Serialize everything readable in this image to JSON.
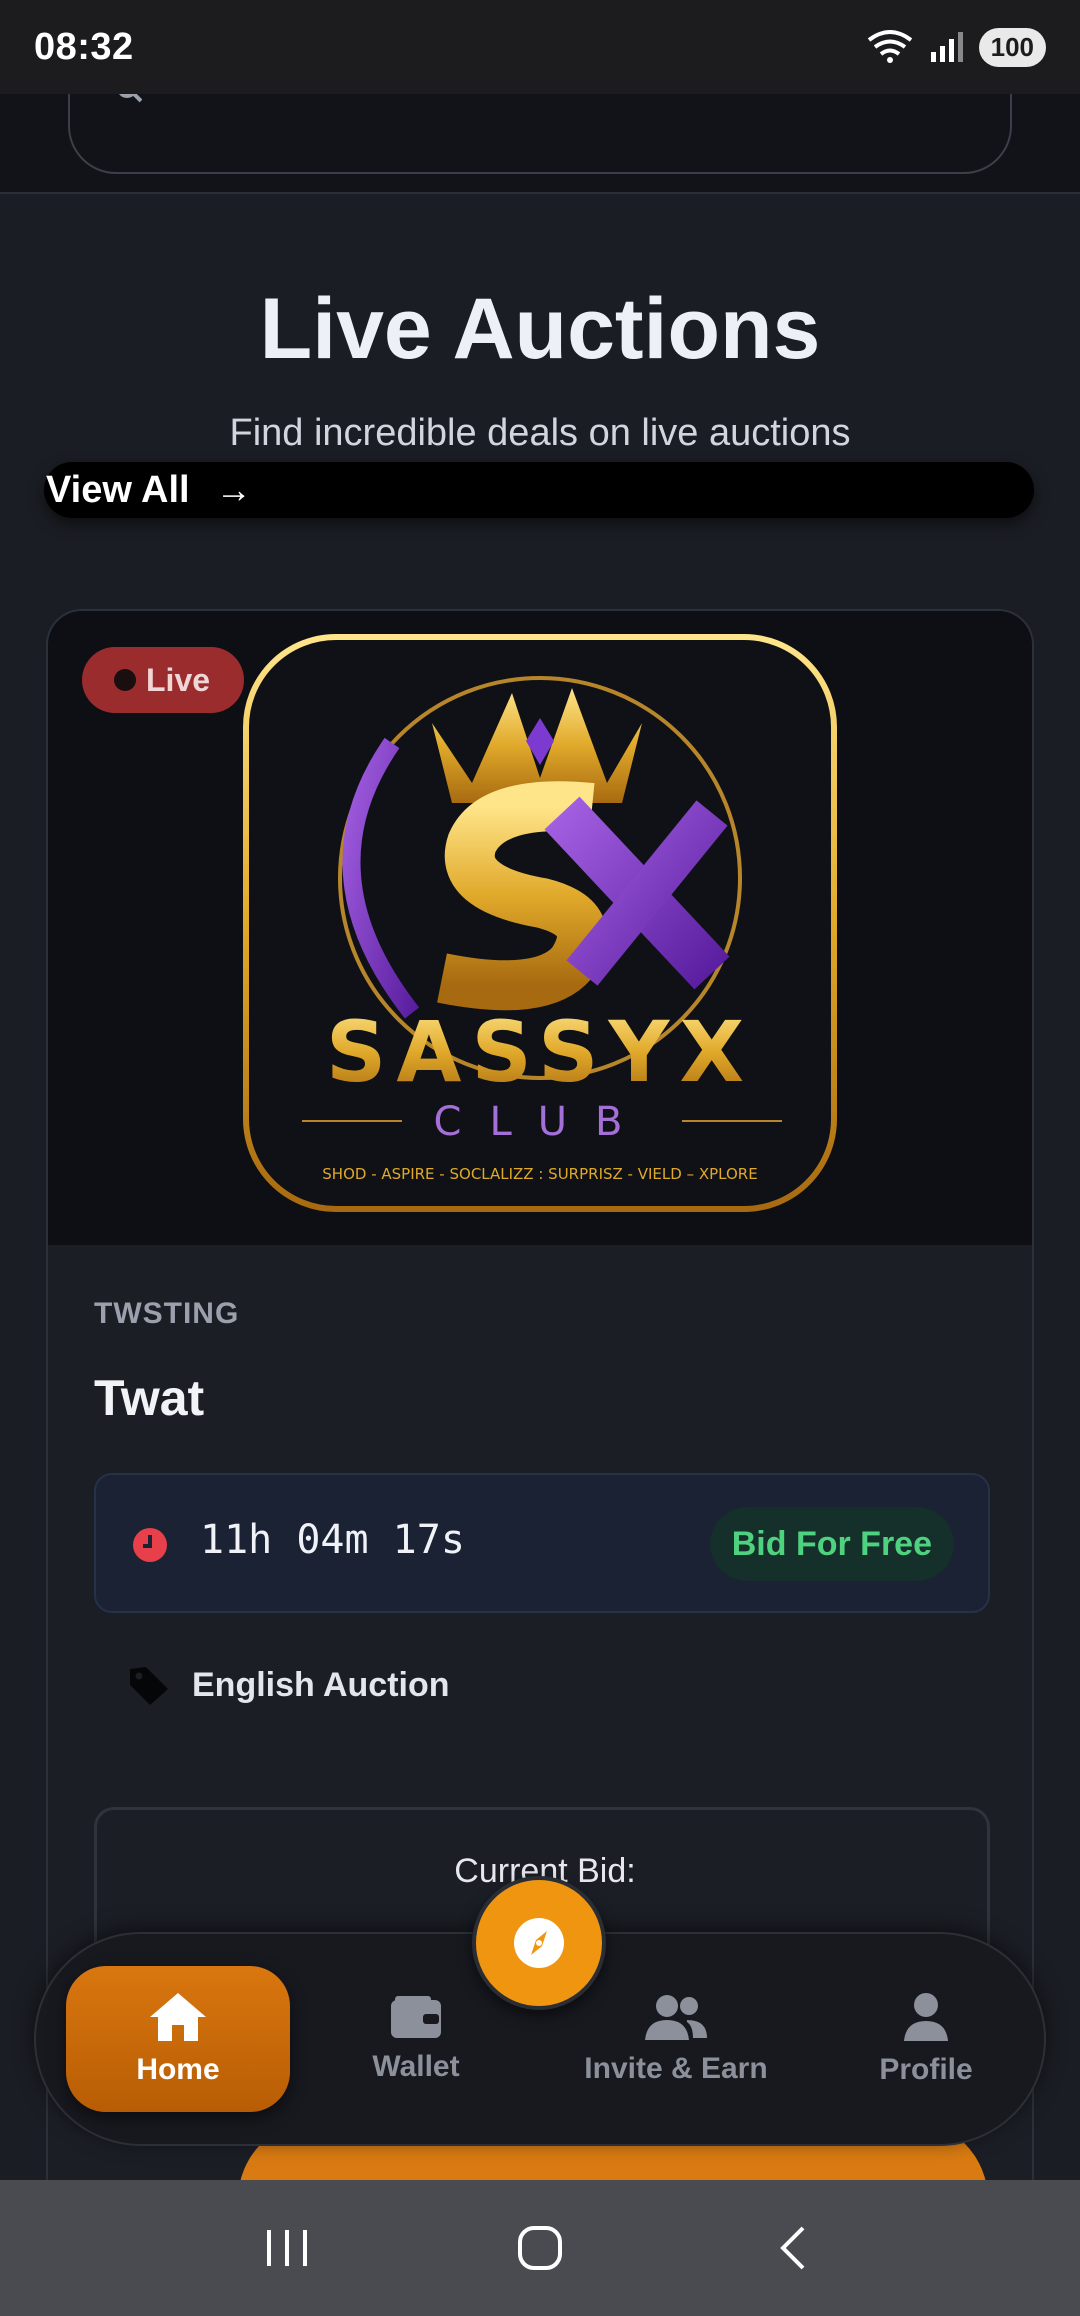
{
  "status_bar": {
    "time": "08:32",
    "battery": "100"
  },
  "hero": {
    "title": "Live Auctions",
    "subtitle": "Find incredible deals on live auctions",
    "view_all": "View All"
  },
  "card": {
    "badge": "Live",
    "logo_text": {
      "brand": "SASSYX",
      "sub": "CLUB",
      "tagline": "SHOD - ASPIRE - SOCLALIZZ : SURPRISZ - VIELD – XPLORE"
    },
    "category": "TWSTING",
    "title": "Twat",
    "timer": "11h 04m 17s",
    "bid_free": "Bid For Free",
    "auction_type": "English Auction",
    "current_bid_label": "Current Bid:"
  },
  "nav": {
    "items": [
      {
        "label": "Home",
        "icon": "home-icon",
        "active": true
      },
      {
        "label": "Wallet",
        "icon": "wallet-icon",
        "active": false
      },
      {
        "label": "Invite & Earn",
        "icon": "users-icon",
        "active": false
      },
      {
        "label": "Profile",
        "icon": "person-icon",
        "active": false
      }
    ],
    "fab_icon": "compass-icon"
  },
  "colors": {
    "accent": "#d9770f",
    "live": "#9b2c2e",
    "success": "#4fd27f"
  }
}
